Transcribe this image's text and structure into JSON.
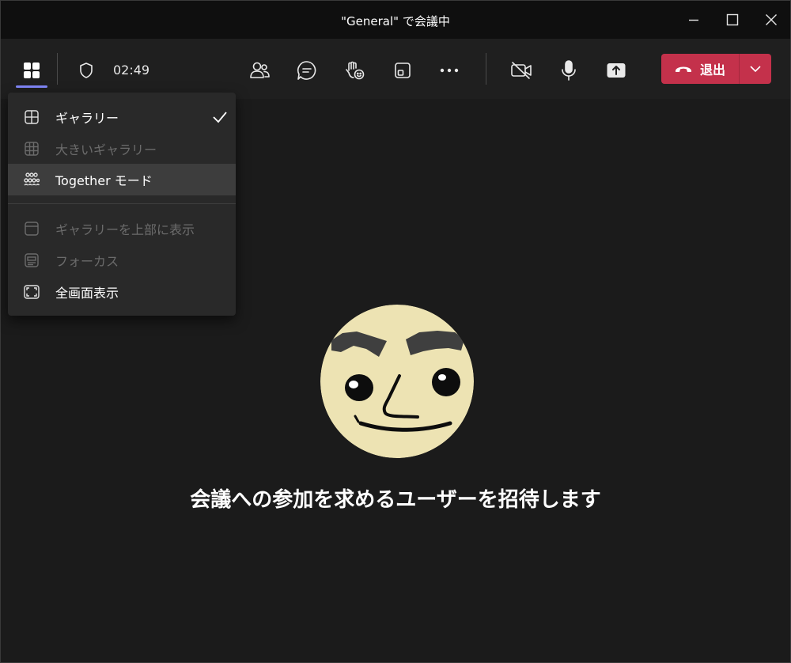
{
  "window": {
    "title": "\"General\" で会議中",
    "controls": [
      "minimize-icon",
      "maximize-icon",
      "close-icon"
    ]
  },
  "toolbar": {
    "timer": "02:49",
    "icons": [
      "view-layout-icon",
      "shield-icon",
      "people-icon",
      "chat-icon",
      "raise-hand-icon",
      "rooms-icon",
      "more-icon",
      "camera-off-icon",
      "microphone-icon",
      "share-icon"
    ],
    "leave_label": "退出",
    "leave_color": "#c4314b",
    "accent_color": "#7f85f5"
  },
  "view_menu": {
    "items": [
      {
        "label": "ギャラリー",
        "icon": "gallery-icon",
        "enabled": true,
        "checked": true
      },
      {
        "label": "大きいギャラリー",
        "icon": "large-gallery-icon",
        "enabled": false
      },
      {
        "label": "Together モード",
        "icon": "together-mode-icon",
        "enabled": true,
        "hovered": true
      },
      {
        "label": "ギャラリーを上部に表示",
        "icon": "gallery-top-icon",
        "enabled": false
      },
      {
        "label": "フォーカス",
        "icon": "focus-icon",
        "enabled": false
      },
      {
        "label": "全画面表示",
        "icon": "fullscreen-icon",
        "enabled": true
      }
    ]
  },
  "main": {
    "invite_text": "会議への参加を求めるユーザーを招待します"
  }
}
